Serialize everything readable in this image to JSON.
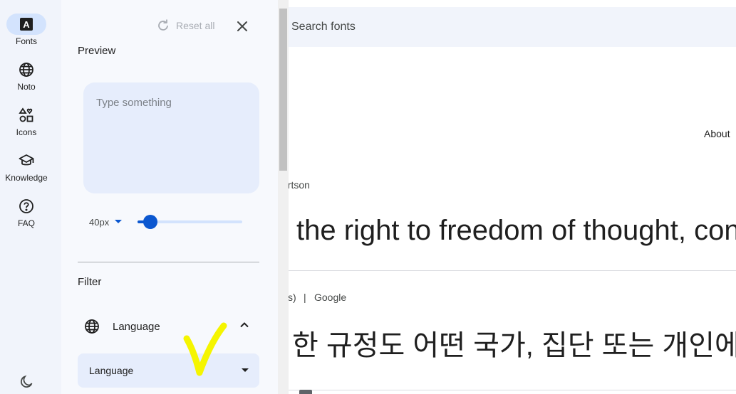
{
  "rail": {
    "items": [
      {
        "label": "Fonts",
        "icon": "fonts-icon",
        "active": true
      },
      {
        "label": "Noto",
        "icon": "globe-icon",
        "active": false
      },
      {
        "label": "Icons",
        "icon": "shapes-icon",
        "active": false
      },
      {
        "label": "Knowledge",
        "icon": "school-icon",
        "active": false
      },
      {
        "label": "FAQ",
        "icon": "help-icon",
        "active": false
      }
    ],
    "theme_icon": "dark-mode-icon"
  },
  "drawer": {
    "reset_label": "Reset all",
    "preview_title": "Preview",
    "preview_placeholder": "Type something",
    "font_size_value": "40px",
    "font_size_slider_fraction": 0.12,
    "filter_title": "Filter",
    "language_section_label": "Language",
    "language_select_label": "Language"
  },
  "main": {
    "search_placeholder": "Search fonts",
    "about_label": "About",
    "cards": [
      {
        "designer": "ertson",
        "sample": "the right to freedom of thought, con"
      },
      {
        "designer_suffix": "s)",
        "separator": "|",
        "designer": "Google",
        "sample": "한 규정도 어떤 국가, 집단 또는 개인에게"
      }
    ]
  },
  "colors": {
    "accent": "#0b57d0",
    "rail_bg": "#f1f4fb",
    "active_pill": "#d3e3fd",
    "annotation": "#f5f500"
  }
}
